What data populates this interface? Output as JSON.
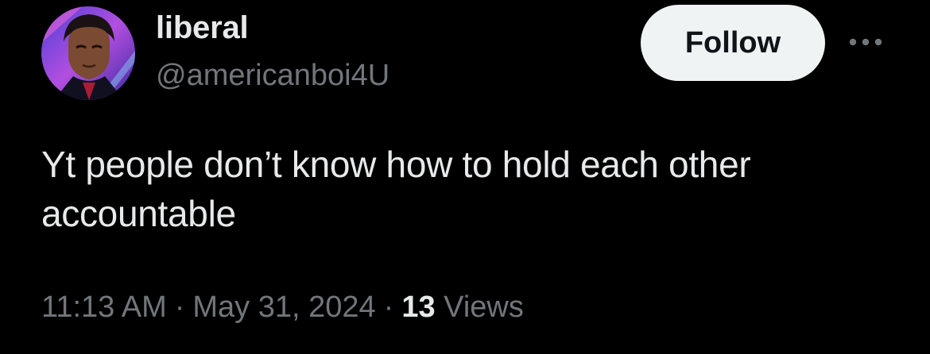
{
  "post": {
    "author": {
      "display_name": "liberal",
      "handle": "@americanboi4U",
      "avatar_icon": "avatar-icon"
    },
    "follow_label": "Follow",
    "more_icon": "more-options-icon",
    "text": "Yt people don’t know how to hold each other accountable",
    "time": "11:13 AM",
    "separator": "·",
    "date": "May 31, 2024",
    "views_count": "13",
    "views_label": "Views"
  },
  "colors": {
    "background": "#000000",
    "primary_text": "#e7e9ea",
    "secondary_text": "#71767b",
    "button_bg": "#eff3f4",
    "button_text": "#0f1419"
  }
}
